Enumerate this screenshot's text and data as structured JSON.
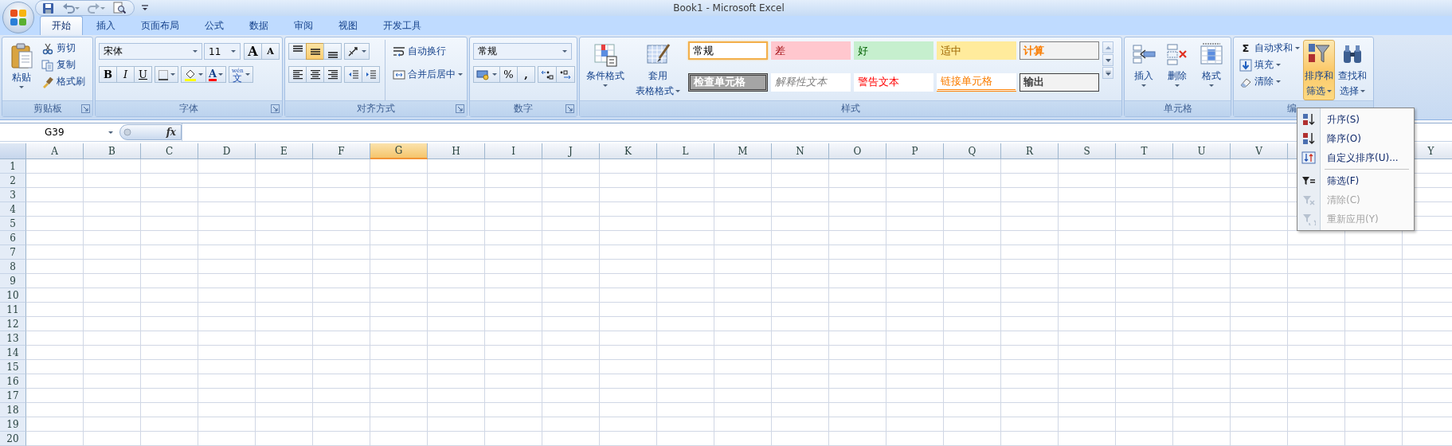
{
  "window": {
    "title": "Book1 - Microsoft Excel"
  },
  "tabs": [
    {
      "label": "开始",
      "selected": true
    },
    {
      "label": "插入",
      "selected": false
    },
    {
      "label": "页面布局",
      "selected": false
    },
    {
      "label": "公式",
      "selected": false
    },
    {
      "label": "数据",
      "selected": false
    },
    {
      "label": "审阅",
      "selected": false
    },
    {
      "label": "视图",
      "selected": false
    },
    {
      "label": "开发工具",
      "selected": false
    }
  ],
  "clipboard": {
    "label": "剪贴板",
    "paste": "粘贴",
    "commands": [
      {
        "kind": "cut",
        "label": "剪切"
      },
      {
        "kind": "copy",
        "label": "复制"
      },
      {
        "kind": "format_painter",
        "label": "格式刷"
      }
    ]
  },
  "font": {
    "label": "字体",
    "font_name": "宋体",
    "font_size": "11",
    "grow": "A",
    "shrink": "A",
    "styles": [
      {
        "kind": "bold",
        "glyph": "B"
      },
      {
        "kind": "italic",
        "glyph": "I"
      },
      {
        "kind": "underline",
        "glyph": "U"
      }
    ],
    "font_color": "A",
    "phonetic": {
      "ruby": "wén",
      "glyph": "文"
    }
  },
  "alignment": {
    "label": "对齐方式",
    "vertical": [
      {
        "selected": false
      },
      {
        "selected": true
      },
      {
        "selected": false
      }
    ],
    "wrap_text": "自动换行",
    "merge": "合并后居中"
  },
  "number": {
    "label": "数字",
    "format": "常规",
    "percent": "%",
    "comma": ","
  },
  "styles": {
    "label": "样式",
    "conditional": "条件格式",
    "table": [
      "套用",
      "表格格式"
    ],
    "gallery": [
      {
        "kind": "normal",
        "label": "常规",
        "selected": true
      },
      {
        "kind": "bad",
        "label": "差",
        "selected": false
      },
      {
        "kind": "good",
        "label": "好",
        "selected": false
      },
      {
        "kind": "neutral",
        "label": "适中",
        "selected": false
      },
      {
        "kind": "calculation",
        "label": "计算",
        "selected": false
      },
      {
        "kind": "check",
        "label": "检查单元格",
        "selected": false
      },
      {
        "kind": "explanatory",
        "label": "解释性文本",
        "selected": false
      },
      {
        "kind": "warning",
        "label": "警告文本",
        "selected": false
      },
      {
        "kind": "linked",
        "label": "链接单元格",
        "selected": false
      },
      {
        "kind": "output",
        "label": "输出",
        "selected": false
      }
    ]
  },
  "cells": {
    "label": "单元格",
    "commands": [
      {
        "kind": "insert",
        "label": "插入"
      },
      {
        "kind": "delete",
        "label": "删除"
      },
      {
        "kind": "format",
        "label": "格式"
      }
    ]
  },
  "editing": {
    "label": "编",
    "commands": [
      {
        "kind": "autosum",
        "glyph": "Σ",
        "label": "自动求和"
      },
      {
        "kind": "fill",
        "label": "填充"
      },
      {
        "kind": "clear",
        "label": "清除"
      }
    ],
    "sort_filter": {
      "lines": [
        "排序和",
        "筛选"
      ],
      "expanded": true
    },
    "find_select": [
      "查找和",
      "选择"
    ]
  },
  "sort_menu": {
    "sections": [
      [
        {
          "kind": "sort_asc",
          "label": "升序(S)",
          "disabled": false
        },
        {
          "kind": "sort_desc",
          "label": "降序(O)",
          "disabled": false
        },
        {
          "kind": "custom_sort",
          "label": "自定义排序(U)...",
          "disabled": false
        }
      ],
      [
        {
          "kind": "filter",
          "label": "筛选(F)",
          "disabled": false
        },
        {
          "kind": "clear_filter",
          "label": "清除(C)",
          "disabled": true
        },
        {
          "kind": "reapply",
          "label": "重新应用(Y)",
          "disabled": true
        }
      ]
    ]
  },
  "formula_bar": {
    "name_box": "G39",
    "fx": "fx"
  },
  "columns": [
    {
      "label": "A",
      "selected": false
    },
    {
      "label": "B",
      "selected": false
    },
    {
      "label": "C",
      "selected": false
    },
    {
      "label": "D",
      "selected": false
    },
    {
      "label": "E",
      "selected": false
    },
    {
      "label": "F",
      "selected": false
    },
    {
      "label": "G",
      "selected": true
    },
    {
      "label": "H",
      "selected": false
    },
    {
      "label": "I",
      "selected": false
    },
    {
      "label": "J",
      "selected": false
    },
    {
      "label": "K",
      "selected": false
    },
    {
      "label": "L",
      "selected": false
    },
    {
      "label": "M",
      "selected": false
    },
    {
      "label": "N",
      "selected": false
    },
    {
      "label": "O",
      "selected": false
    },
    {
      "label": "P",
      "selected": false
    },
    {
      "label": "Q",
      "selected": false
    },
    {
      "label": "R",
      "selected": false
    },
    {
      "label": "S",
      "selected": false
    },
    {
      "label": "T",
      "selected": false
    },
    {
      "label": "U",
      "selected": false
    },
    {
      "label": "V",
      "selected": false
    },
    {
      "label": "Y",
      "selected": false
    }
  ],
  "rows": [
    "1",
    "2",
    "3",
    "4",
    "5",
    "6",
    "7",
    "8",
    "9",
    "10",
    "11",
    "12",
    "13",
    "14",
    "15",
    "16",
    "17",
    "18",
    "19",
    "20"
  ]
}
